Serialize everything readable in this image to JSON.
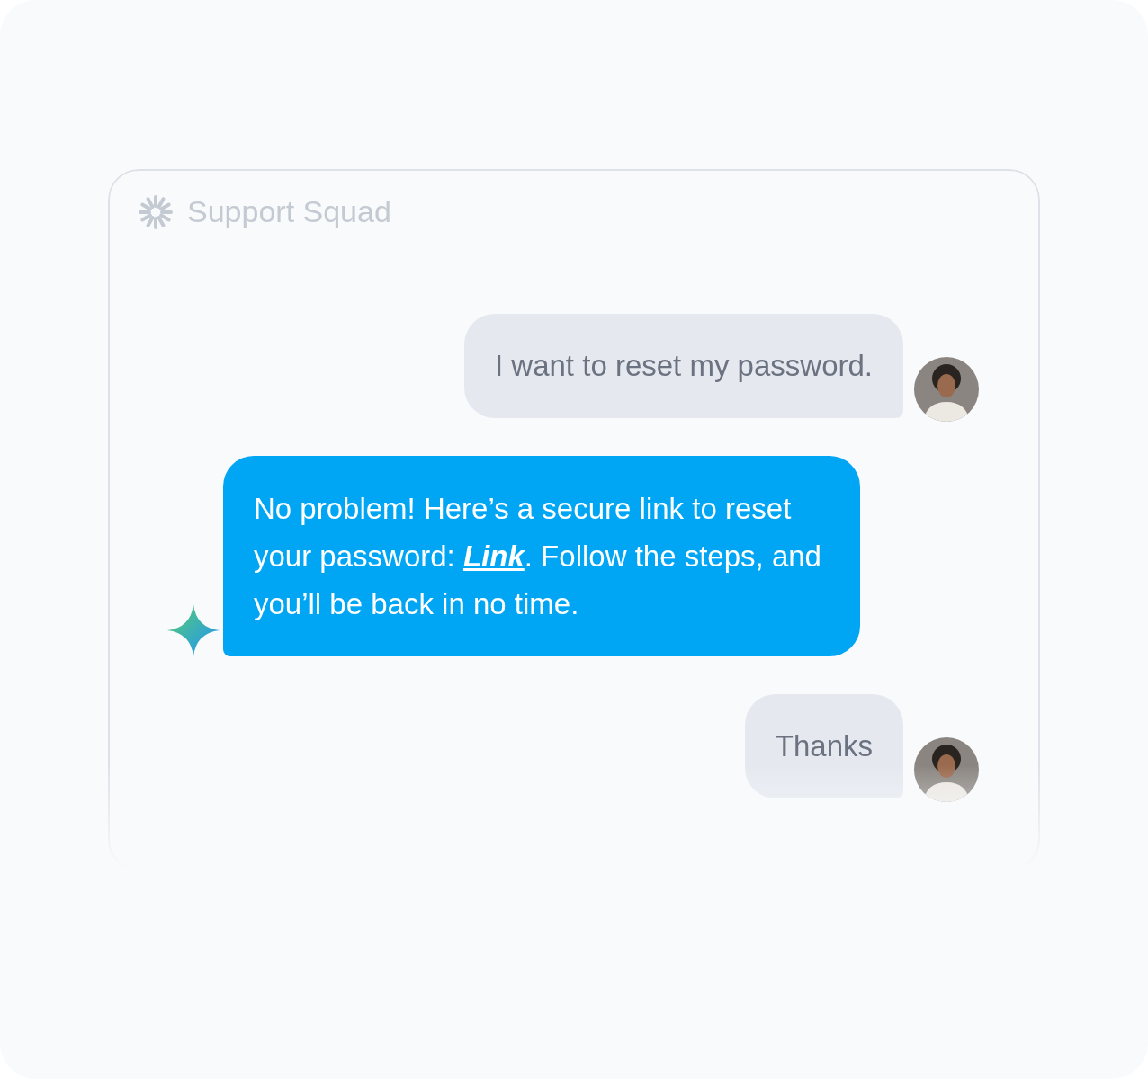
{
  "header": {
    "title": "Support Squad"
  },
  "messages": [
    {
      "kind": "user",
      "text": "I want to reset my password."
    },
    {
      "kind": "bot",
      "text_before": "No problem! Here’s a secure link to reset your password: ",
      "link": "Link",
      "text_after": ". Follow the steps, and you’ll be back in no time."
    },
    {
      "kind": "user",
      "text": "Thanks"
    }
  ]
}
